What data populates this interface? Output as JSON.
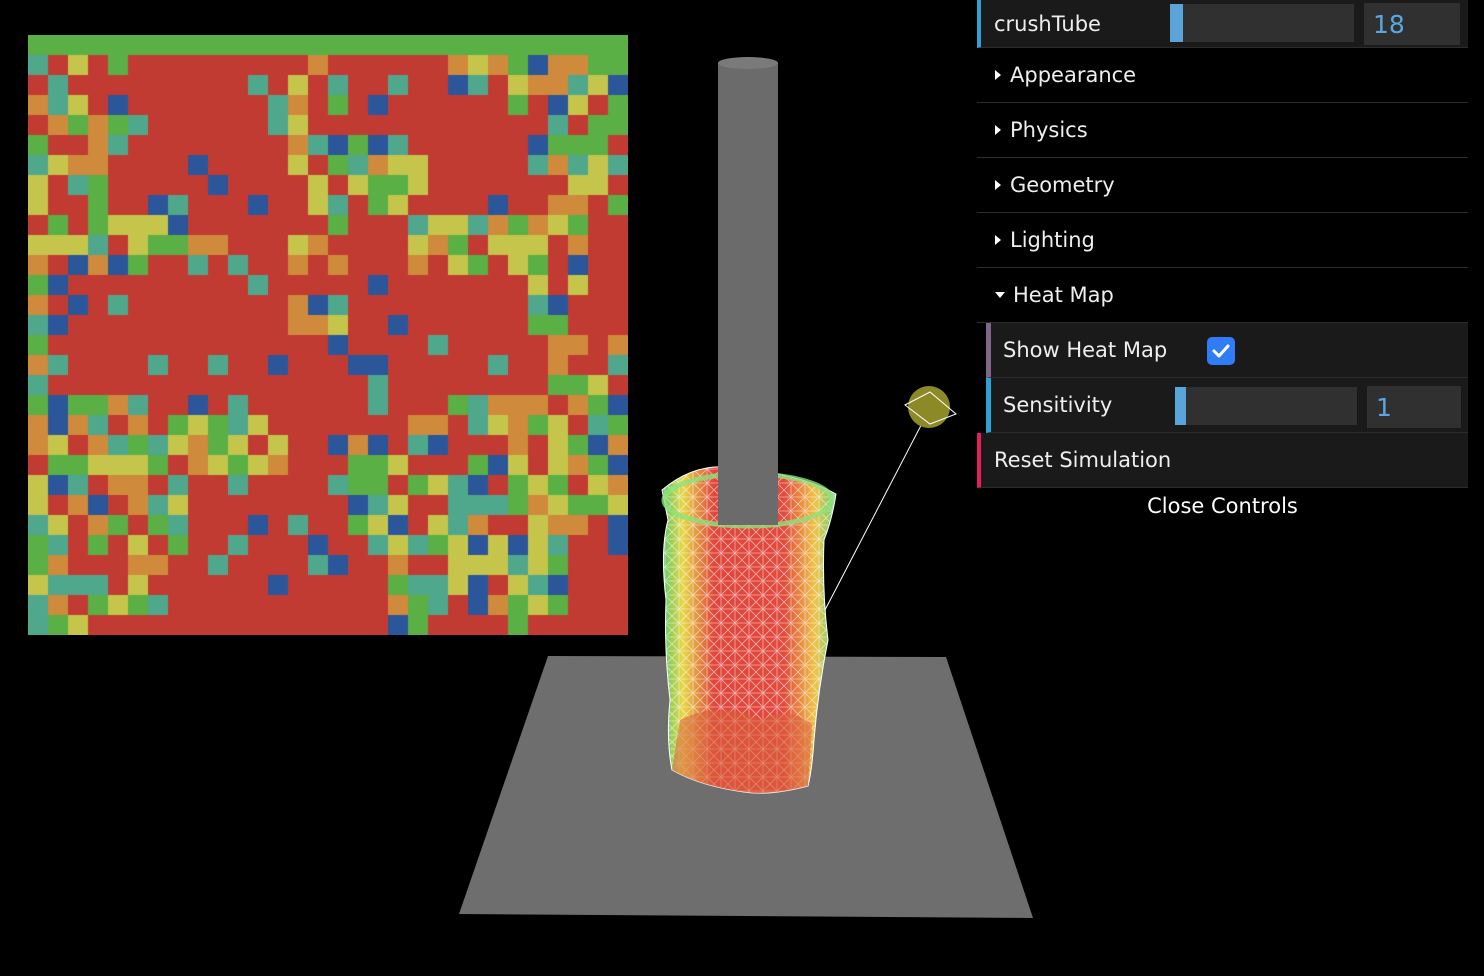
{
  "gui": {
    "crush_tube": {
      "label": "crushTube",
      "value": "18",
      "fraction": 0.07
    },
    "folders": [
      {
        "label": "Appearance",
        "open": false
      },
      {
        "label": "Physics",
        "open": false
      },
      {
        "label": "Geometry",
        "open": false
      },
      {
        "label": "Lighting",
        "open": false
      },
      {
        "label": "Heat Map",
        "open": true
      }
    ],
    "heat_map": {
      "show": {
        "label": "Show Heat Map",
        "checked": true
      },
      "sensitivity": {
        "label": "Sensitivity",
        "value": "1",
        "fraction": 0.06
      }
    },
    "reset_label": "Reset Simulation",
    "close_label": "Close Controls"
  },
  "colors": {
    "background": "#000000",
    "heat_red": "#c23b33",
    "heat_orange": "#cf8a3b",
    "heat_yellow": "#c4c54a",
    "heat_green": "#5aaf45",
    "heat_teal": "#4fa78c",
    "heat_blue": "#2b5699",
    "floor": "#6e6e6e",
    "rod": "#6b6b6b",
    "light_handle": "#8c8a26",
    "accent": "#2fa1d6"
  }
}
